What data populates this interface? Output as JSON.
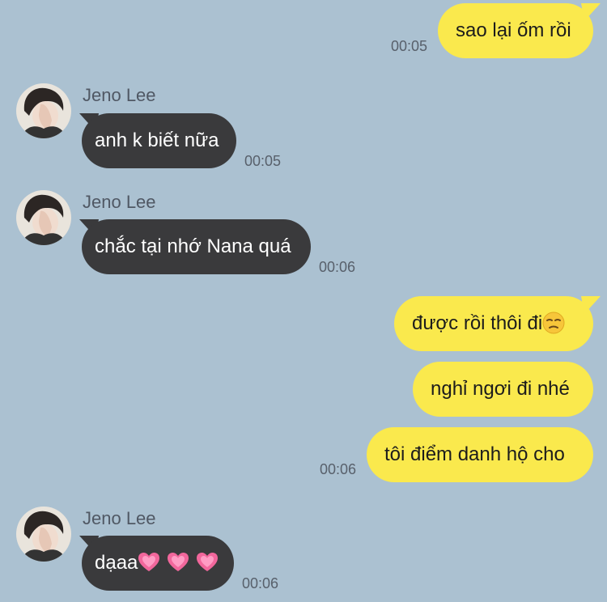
{
  "contact": {
    "name": "Jeno Lee"
  },
  "messages": [
    {
      "direction": "outgoing",
      "text": "sao lại ốm rồi",
      "time": "00:05"
    },
    {
      "direction": "incoming",
      "sender": "Jeno Lee",
      "text": "anh k biết nữa",
      "time": "00:05"
    },
    {
      "direction": "incoming",
      "sender": "Jeno Lee",
      "text": "chắc tại nhớ Nana quá",
      "time": "00:06"
    },
    {
      "direction": "outgoing",
      "text": "được rồi thôi đi",
      "emoji": "unamused-face",
      "time": ""
    },
    {
      "direction": "outgoing",
      "text": "nghỉ ngơi đi nhé",
      "time": ""
    },
    {
      "direction": "outgoing",
      "text": "tôi điểm danh hộ cho",
      "time": "00:06"
    },
    {
      "direction": "incoming",
      "sender": "Jeno Lee",
      "text": "dạaa",
      "emoji": "growing-heart x3",
      "time": "00:06"
    }
  ],
  "colors": {
    "background": "#abc1d1",
    "outgoing_bubble": "#fae94d",
    "incoming_bubble": "#3a3a3c",
    "timestamp": "#58606b",
    "sender_name": "#505864",
    "heart": "#f2679c"
  }
}
